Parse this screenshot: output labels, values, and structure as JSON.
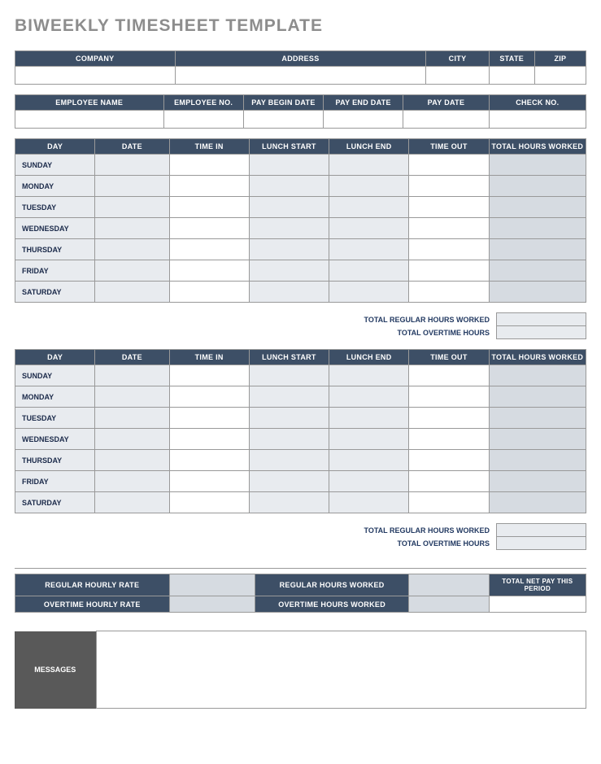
{
  "title": "BIWEEKLY TIMESHEET TEMPLATE",
  "company_table": {
    "headers": [
      "COMPANY",
      "ADDRESS",
      "CITY",
      "STATE",
      "ZIP"
    ],
    "values": [
      "",
      "",
      "",
      "",
      ""
    ]
  },
  "employee_table": {
    "headers": [
      "EMPLOYEE NAME",
      "EMPLOYEE NO.",
      "PAY BEGIN DATE",
      "PAY END DATE",
      "PAY DATE",
      "CHECK NO."
    ],
    "values": [
      "",
      "",
      "",
      "",
      "",
      ""
    ]
  },
  "week_headers": [
    "DAY",
    "DATE",
    "TIME IN",
    "LUNCH START",
    "LUNCH END",
    "TIME OUT",
    "TOTAL HOURS WORKED"
  ],
  "days": [
    "SUNDAY",
    "MONDAY",
    "TUESDAY",
    "WEDNESDAY",
    "THURSDAY",
    "FRIDAY",
    "SATURDAY"
  ],
  "subtotals": {
    "regular": "TOTAL REGULAR HOURS WORKED",
    "overtime": "TOTAL OVERTIME HOURS",
    "reg_val1": "",
    "ot_val1": "",
    "reg_val2": "",
    "ot_val2": ""
  },
  "rates": {
    "reg_rate": "REGULAR HOURLY RATE",
    "reg_hours": "REGULAR HOURS WORKED",
    "ot_rate": "OVERTIME HOURLY RATE",
    "ot_hours": "OVERTIME HOURS WORKED",
    "net_pay": "TOTAL NET PAY THIS PERIOD",
    "reg_rate_val": "",
    "reg_hours_val": "",
    "ot_rate_val": "",
    "ot_hours_val": "",
    "net_pay_val": ""
  },
  "messages": {
    "label": "MESSAGES",
    "value": ""
  }
}
